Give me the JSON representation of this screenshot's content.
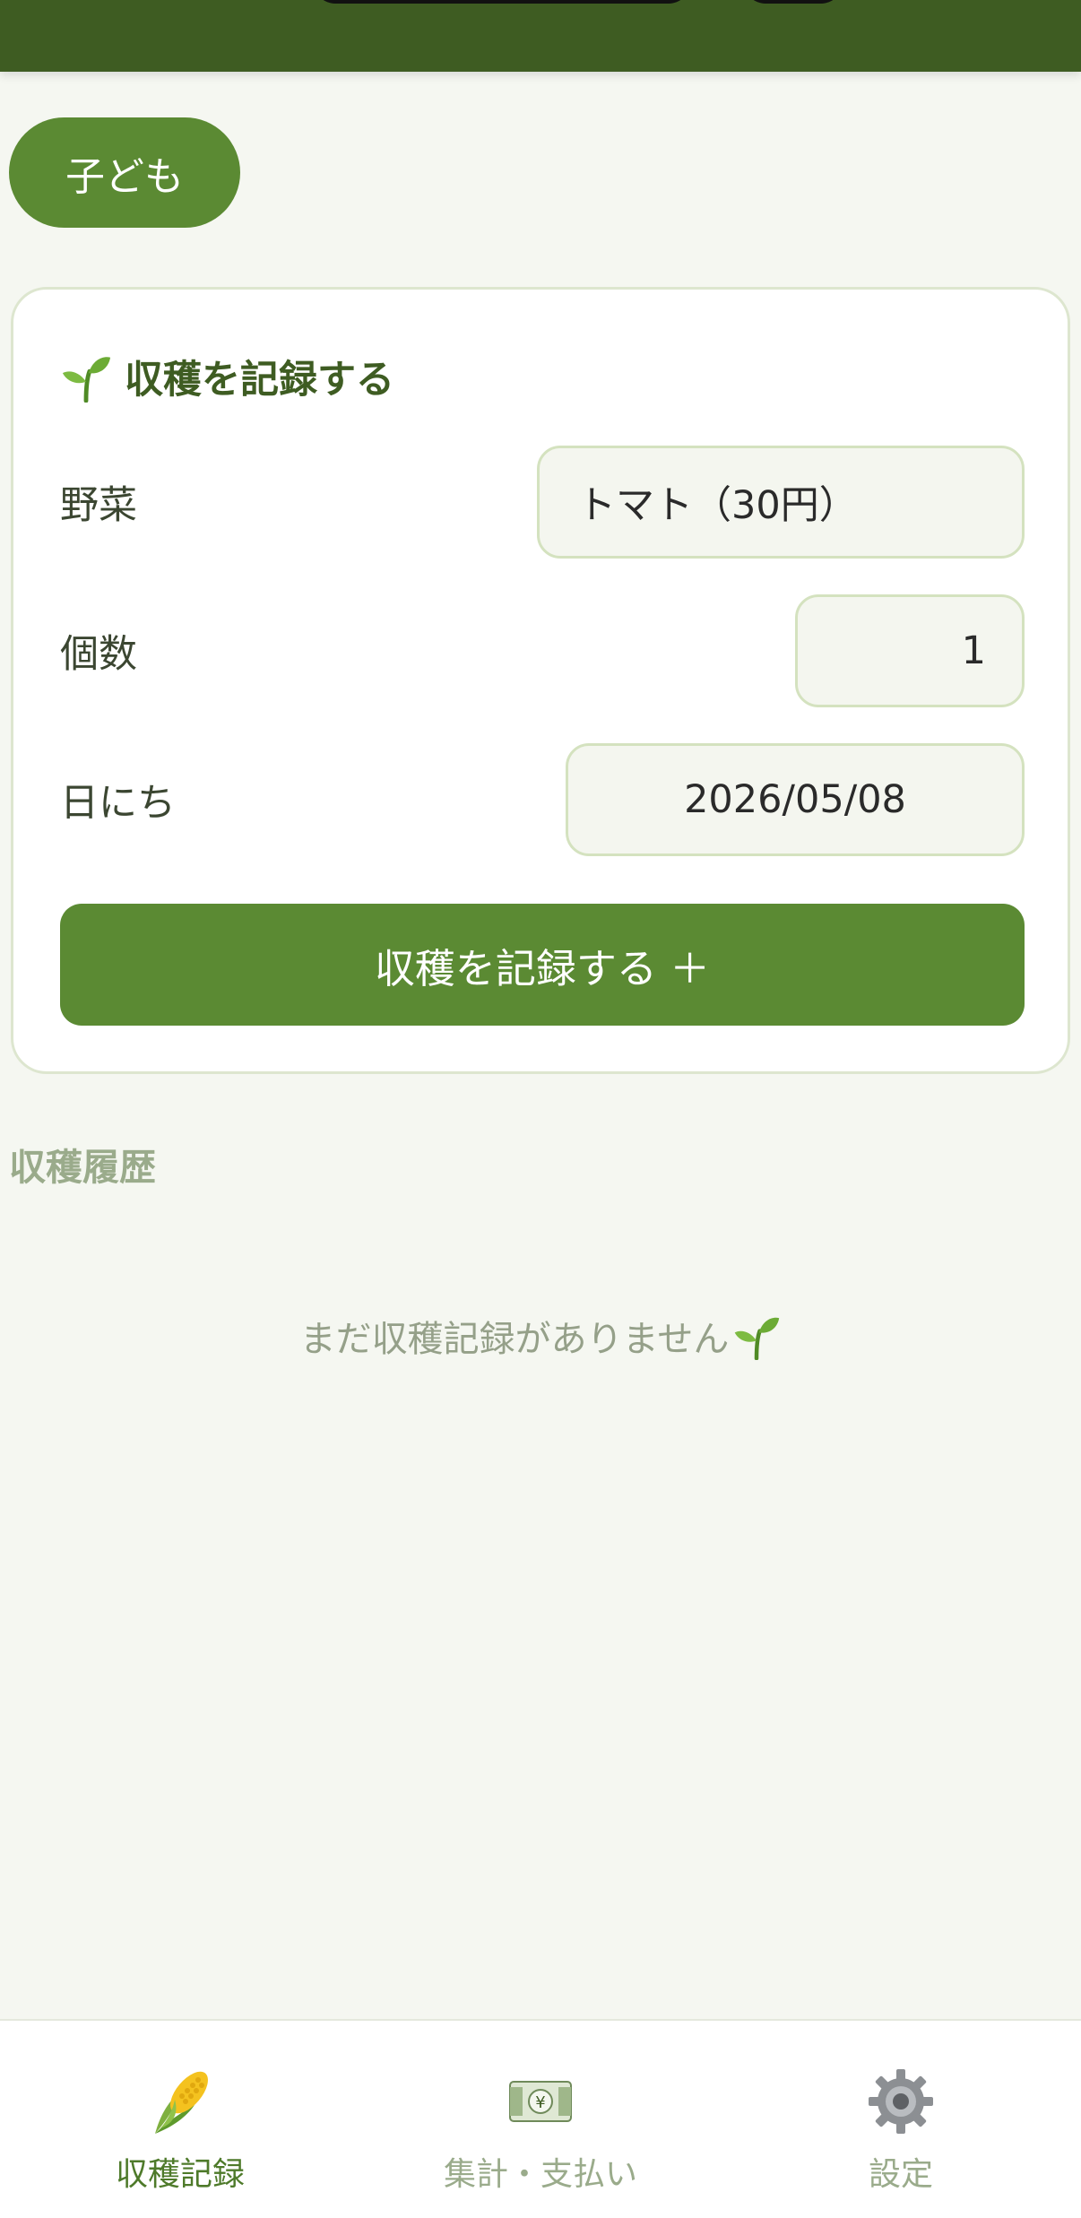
{
  "colors": {
    "header": "#3e5c22",
    "accent": "#5b8a33",
    "background": "#f5f7f1",
    "muted_text": "#9aab8b"
  },
  "profile": {
    "active_child_label": "子ども"
  },
  "record_form": {
    "title": "収穫を記録する",
    "title_icon": "sprout-icon",
    "vegetable_label": "野菜",
    "vegetable_value": "トマト（30円）",
    "quantity_label": "個数",
    "quantity_value": "1",
    "date_label": "日にち",
    "date_value": "2026/05/08",
    "submit_label": "収穫を記録する ＋"
  },
  "history": {
    "heading": "収穫履歴",
    "empty_message": "まだ収穫記録がありません",
    "empty_icon": "sprout-icon"
  },
  "bottom_nav": {
    "items": [
      {
        "label": "収穫記録",
        "icon": "corn-icon",
        "active": true
      },
      {
        "label": "集計・支払い",
        "icon": "banknote-icon",
        "active": false
      },
      {
        "label": "設定",
        "icon": "gear-icon",
        "active": false
      }
    ]
  }
}
